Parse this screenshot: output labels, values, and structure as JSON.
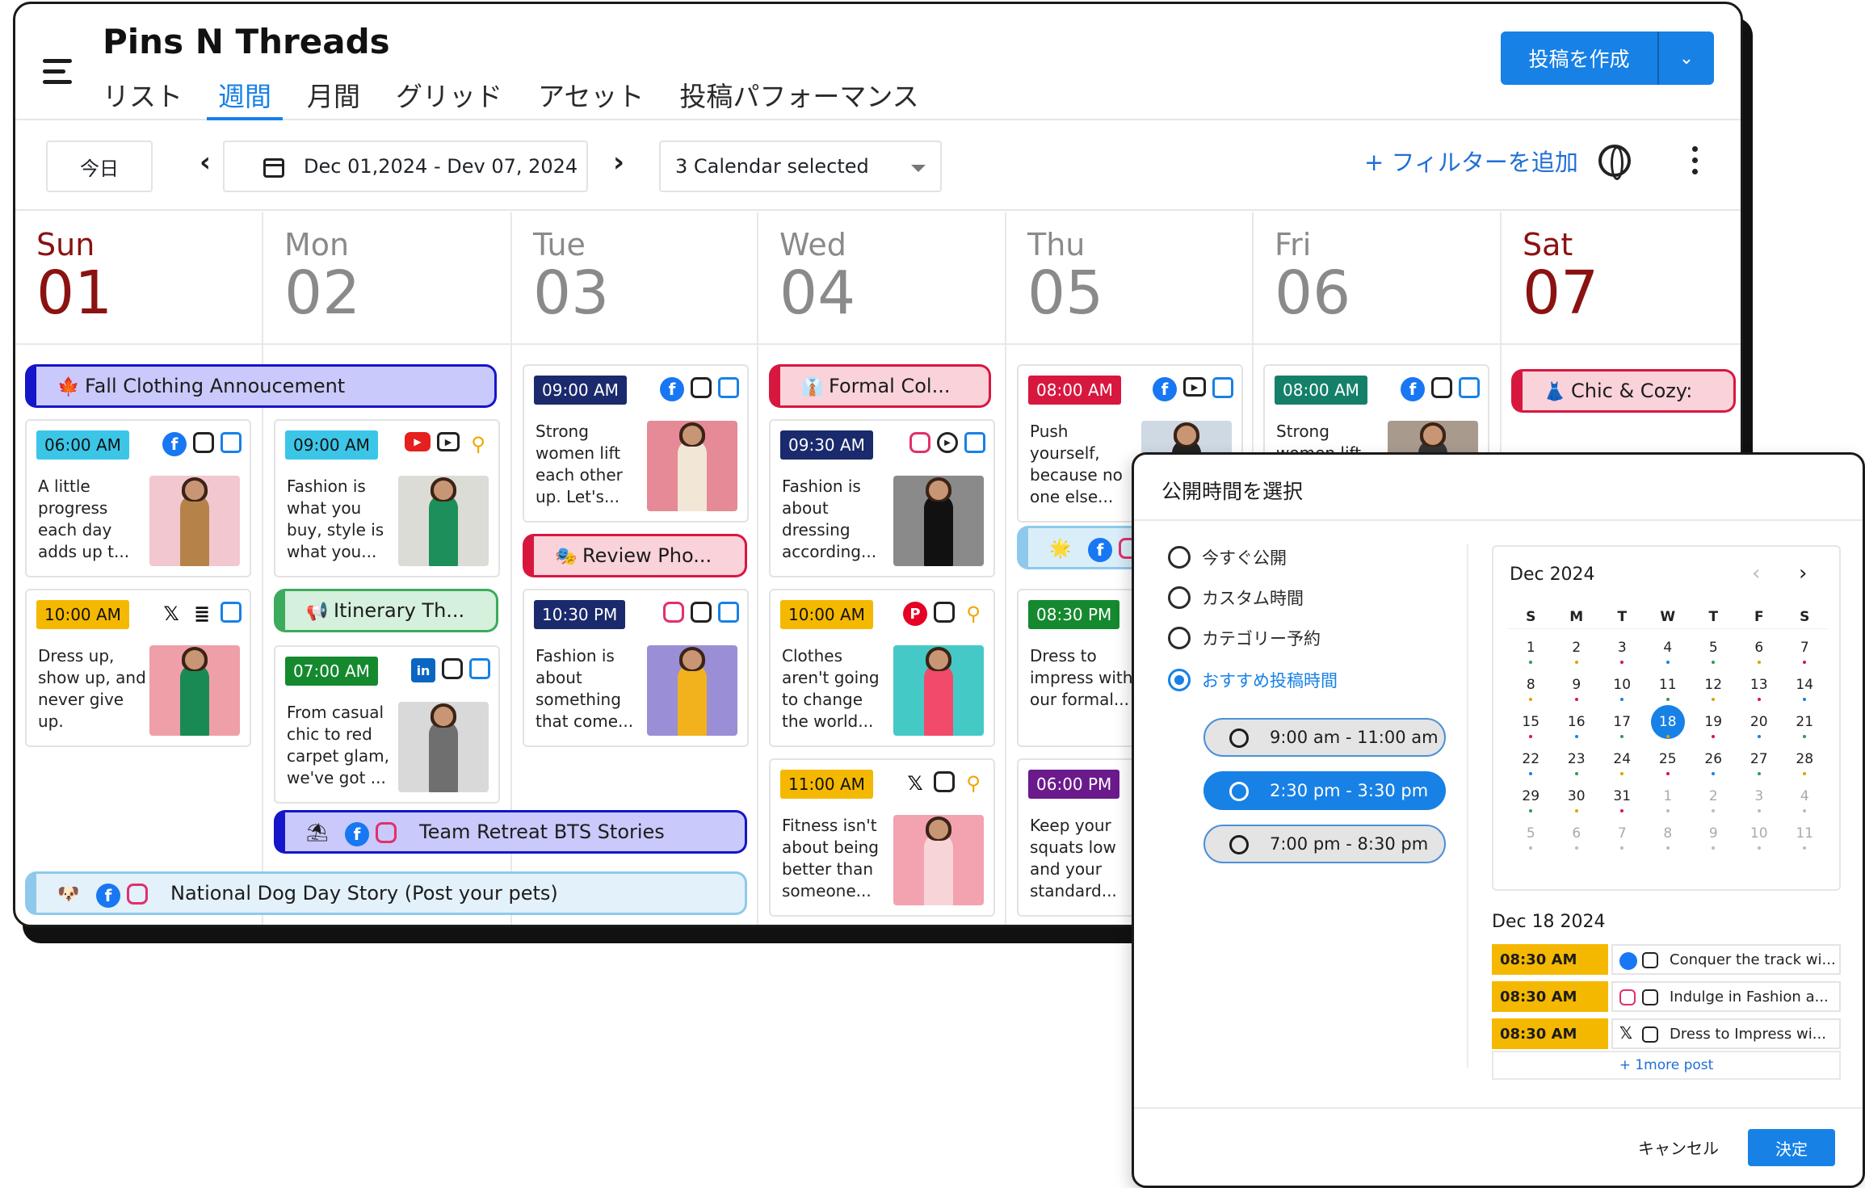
{
  "app": {
    "title": "Pins N Threads",
    "create_label": "投稿を作成"
  },
  "tabs": [
    "リスト",
    "週間",
    "月間",
    "グリッド",
    "アセット",
    "投稿パフォーマンス"
  ],
  "active_tab": "週間",
  "toolbar": {
    "today": "今日",
    "date_range": "Dec 01,2024 - Dev 07, 2024",
    "calendar_select": "3 Calendar selected",
    "add_filter": "+ フィルターを追加"
  },
  "days": [
    {
      "wd": "Sun",
      "dn": "01"
    },
    {
      "wd": "Mon",
      "dn": "02"
    },
    {
      "wd": "Tue",
      "dn": "03"
    },
    {
      "wd": "Wed",
      "dn": "04"
    },
    {
      "wd": "Thu",
      "dn": "05"
    },
    {
      "wd": "Fri",
      "dn": "06"
    },
    {
      "wd": "Sat",
      "dn": "07"
    }
  ],
  "events": {
    "fall": {
      "emoji": "🍁",
      "label": "Fall Clothing Annoucement"
    },
    "formal": {
      "emoji": "👔",
      "label": "Formal Col..."
    },
    "chic": {
      "emoji": "👗",
      "label": "Chic & Cozy:"
    },
    "review": {
      "emoji": "🎭",
      "label": "Review Pho..."
    },
    "itinerary": {
      "emoji": "📢",
      "label": "Itinerary Th..."
    },
    "retreat": {
      "emoji": "⛱",
      "label": "Team Retreat BTS Stories"
    },
    "dog": {
      "emoji": "🐶",
      "label": "National Dog Day Story (Post your pets)"
    },
    "thu_pill": {
      "emoji": "🌟"
    }
  },
  "posts": {
    "sun1": {
      "time": "06:00 AM",
      "text": "A little progress each day adds up t..."
    },
    "sun2": {
      "time": "10:00 AM",
      "text": "Dress up, show up, and never give up."
    },
    "mon1": {
      "time": "09:00 AM",
      "text": "Fashion is what you buy, style is what you..."
    },
    "mon2": {
      "time": "07:00 AM",
      "text": "From casual chic to red carpet glam, we've got ..."
    },
    "tue1": {
      "time": "09:00 AM",
      "text": "Strong women lift each other up. Let's..."
    },
    "tue2": {
      "time": "10:30 PM",
      "text": "Fashion is about something that come..."
    },
    "wed1": {
      "time": "09:30 AM",
      "text": "Fashion is about dressing according..."
    },
    "wed2": {
      "time": "10:00 AM",
      "text": "Clothes aren't going to change the world..."
    },
    "wed3": {
      "time": "11:00 AM",
      "text": "Fitness isn't about being better than someone..."
    },
    "thu1": {
      "time": "08:00 AM",
      "text": "Push yourself, because no one else..."
    },
    "thu2": {
      "time": "08:30 PM",
      "text": "Dress to impress with our formal..."
    },
    "thu3": {
      "time": "06:00 PM",
      "text": "Keep your squats low and your standard..."
    },
    "fri1": {
      "time": "08:00 AM",
      "text": "Strong women lift"
    }
  },
  "modal": {
    "title": "公開時間を選択",
    "options": [
      "今すぐ公開",
      "カスタム時間",
      "カテゴリー予約",
      "おすすめ投稿時間"
    ],
    "selected_option": "おすすめ投稿時間",
    "slots": [
      "9:00 am - 11:00 am",
      "2:30 pm - 3:30 pm",
      "7:00 pm - 8:30 pm"
    ],
    "selected_slot": "2:30 pm - 3:30 pm",
    "calendar": {
      "month": "Dec 2024",
      "weekdays": [
        "S",
        "M",
        "T",
        "W",
        "T",
        "F",
        "S"
      ],
      "weeks": [
        [
          "1",
          "2",
          "3",
          "4",
          "5",
          "6",
          "7"
        ],
        [
          "8",
          "9",
          "10",
          "11",
          "12",
          "13",
          "14"
        ],
        [
          "15",
          "16",
          "17",
          "18",
          "19",
          "20",
          "21"
        ],
        [
          "22",
          "23",
          "24",
          "25",
          "26",
          "27",
          "28"
        ],
        [
          "29",
          "30",
          "31",
          "1",
          "2",
          "3",
          "4"
        ],
        [
          "5",
          "6",
          "7",
          "8",
          "9",
          "10",
          "11"
        ]
      ],
      "selected_day": "18"
    },
    "schedule_title": "Dec 18 2024",
    "schedule": [
      {
        "time": "08:30 AM",
        "text": "Conquer the track wi..."
      },
      {
        "time": "08:30 AM",
        "text": "Indulge in Fashion a..."
      },
      {
        "time": "08:30 AM",
        "text": "Dress to Impress wi..."
      }
    ],
    "more": "+ 1more post",
    "cancel": "キャンセル",
    "confirm": "決定"
  }
}
